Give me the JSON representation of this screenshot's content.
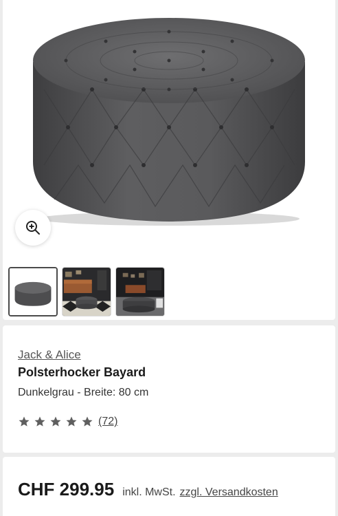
{
  "product": {
    "brand": "Jack & Alice",
    "name": "Polsterhocker Bayard",
    "variant": "Dunkelgrau - Breite: 80 cm"
  },
  "rating": {
    "stars": 5,
    "review_count": "(72)",
    "star_color": "#5f5f5f"
  },
  "price": {
    "amount": "CHF 299.95",
    "tax_note": "inkl. MwSt.",
    "shipping_link": "zzgl. Versandkosten"
  },
  "gallery": {
    "zoom_icon": "zoom-in-icon",
    "thumbnails": [
      {
        "name": "ottoman-product-photo",
        "active": true
      },
      {
        "name": "living-room-photo-1",
        "active": false
      },
      {
        "name": "living-room-photo-2",
        "active": false
      }
    ]
  },
  "colors": {
    "upholstery": "#5a5a5c",
    "page_background": "#ececec",
    "card_background": "#ffffff"
  }
}
